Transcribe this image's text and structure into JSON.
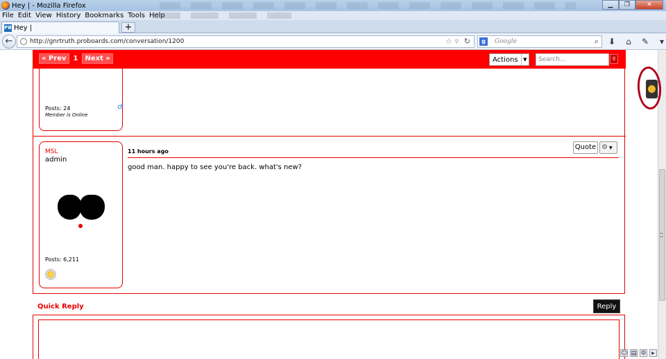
{
  "window": {
    "title": "Hey | - Mozilla Firefox"
  },
  "menu": [
    "File",
    "Edit",
    "View",
    "History",
    "Bookmarks",
    "Tools",
    "Help"
  ],
  "tab": {
    "label": "Hey |",
    "favicon": "PB"
  },
  "newtab": "+",
  "nav": {
    "url": "http://gnrtruth.proboards.com/conversation/1200",
    "search_placeholder": "Google"
  },
  "forum": {
    "prev_label": "« Prev",
    "page_number": "1",
    "next_label": "Next »",
    "actions_label": "Actions",
    "search_placeholder": "Search..."
  },
  "previous_post": {
    "posts": "Posts: 24",
    "online": "Member is Online"
  },
  "post": {
    "username": "MSL",
    "role": "admin",
    "posts": "Posts: 6,211",
    "time": "11 hours ago",
    "quote_label": "Quote",
    "body": "good man. happy to see you're back. what's new?"
  },
  "quick_reply": {
    "title": "Quick Reply",
    "reply_label": "Reply"
  },
  "colors": {
    "accent": "#ff0000",
    "annotation_circle": "#b0001c"
  }
}
